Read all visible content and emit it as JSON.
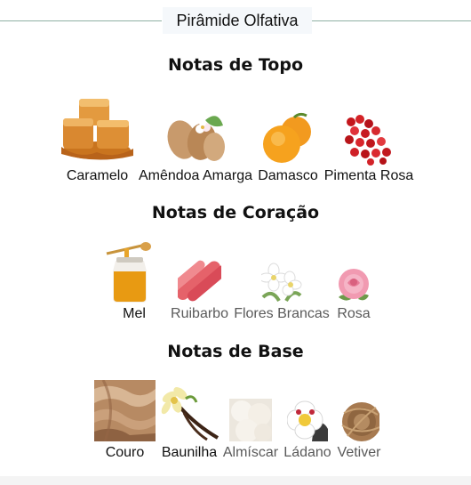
{
  "header": {
    "title": "Pirâmide Olfativa"
  },
  "sections": {
    "top": {
      "title": "Notas de Topo",
      "notes": [
        {
          "label": "Caramelo",
          "icon": "caramel-icon"
        },
        {
          "label": "Amêndoa Amarga",
          "icon": "almond-icon"
        },
        {
          "label": "Damasco",
          "icon": "apricot-icon"
        },
        {
          "label": "Pimenta Rosa",
          "icon": "pink-pepper-icon"
        }
      ]
    },
    "heart": {
      "title": "Notas de Coração",
      "notes": [
        {
          "label": "Mel",
          "icon": "honey-icon"
        },
        {
          "label": "Ruibarbo",
          "icon": "rhubarb-icon"
        },
        {
          "label": "Flores Brancas",
          "icon": "white-flowers-icon"
        },
        {
          "label": "Rosa",
          "icon": "rose-icon"
        }
      ]
    },
    "base": {
      "title": "Notas de Base",
      "notes": [
        {
          "label": "Couro",
          "icon": "leather-icon"
        },
        {
          "label": "Baunilha",
          "icon": "vanilla-icon"
        },
        {
          "label": "Almíscar",
          "icon": "musk-icon"
        },
        {
          "label": "Ládano",
          "icon": "labdanum-icon"
        },
        {
          "label": "Vetiver",
          "icon": "vetiver-icon"
        }
      ]
    }
  },
  "colors": {
    "divider": "#8fb0a4",
    "header_bg": "#f5f8fb",
    "dark_text": "#111111",
    "grey_text": "#5a5a5a"
  }
}
